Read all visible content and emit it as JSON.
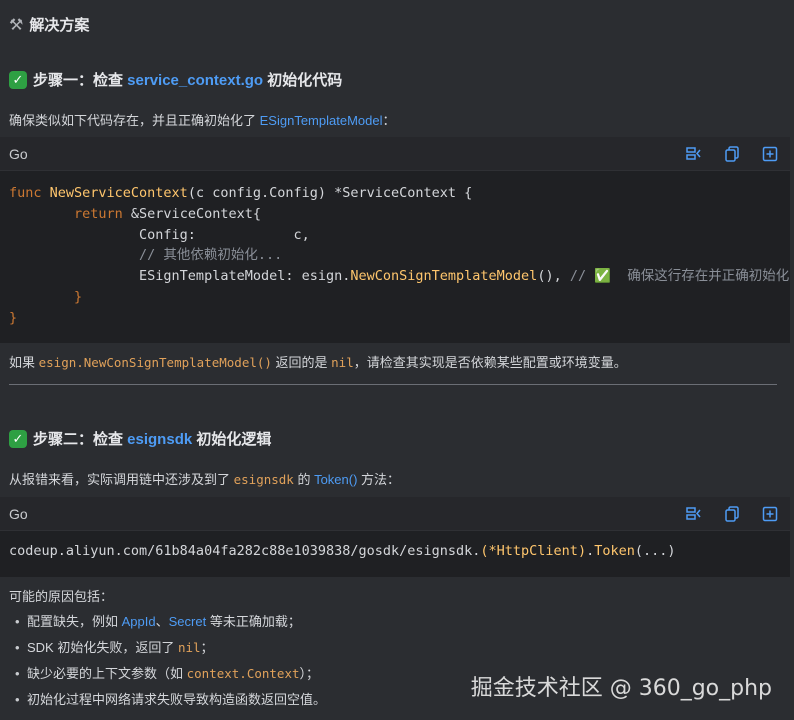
{
  "header": {
    "icon": "hammer-wrench-icon",
    "title": "解决方案"
  },
  "step1": {
    "prefix": "步骤一：检查 ",
    "highlight": "service_context.go",
    "suffix": " 初始化代码",
    "desc_prefix": "确保类似如下代码存在，并且正确初始化了 ",
    "desc_link": "ESignTemplateModel",
    "desc_suffix": "：",
    "code": {
      "lang": "Go",
      "l1_kw": "func ",
      "l1_fn": "NewServiceContext",
      "l1_rest": "(c config.Config) *ServiceContext {",
      "l2_kw": "        return ",
      "l2_rest": "&ServiceContext{",
      "l3": "                Config:            c,",
      "l4": "                // 其他依赖初始化...",
      "l5_a": "                ESignTemplateModel: esign.",
      "l5_fn": "NewConSignTemplateModel",
      "l5_b": "(), ",
      "l5_cm": "// ✅  确保这行存在并正确初始化",
      "l6": "        }",
      "l7": "}"
    },
    "after_prefix": "如果 ",
    "after_code1": "esign.NewConSignTemplateModel()",
    "after_mid": " 返回的是 ",
    "after_code2": "nil",
    "after_suffix": "，请检查其实现是否依赖某些配置或环境变量。"
  },
  "step2": {
    "prefix": "步骤二：检查 ",
    "highlight": "esignsdk",
    "suffix": " 初始化逻辑",
    "desc_prefix": "从报错来看，实际调用链中还涉及到了 ",
    "desc_code": "esignsdk",
    "desc_mid": " 的 ",
    "desc_link": "Token()",
    "desc_suffix": " 方法：",
    "code": {
      "lang": "Go",
      "line_a": "codeup.aliyun.com/61b84a04fa282c88e1039838/gosdk/esignsdk.",
      "line_b": "(*HttpClient)",
      "line_c": ".",
      "line_fn": "Token",
      "line_d": "(...)"
    },
    "reasons_title": "可能的原因包括：",
    "reasons": {
      "r1_a": "配置缺失，例如 ",
      "r1_l1": "AppId",
      "r1_b": "、",
      "r1_l2": "Secret",
      "r1_c": " 等未正确加载；",
      "r2_a": "SDK 初始化失败，返回了 ",
      "r2_code": "nil",
      "r2_b": "；",
      "r3_a": "缺少必要的上下文参数（如 ",
      "r3_code": "context.Context",
      "r3_b": "）；",
      "r4": "初始化过程中网络请求失败导致构造函数返回空值。"
    }
  },
  "watermark": "掘金技术社区 @ 360_go_php"
}
